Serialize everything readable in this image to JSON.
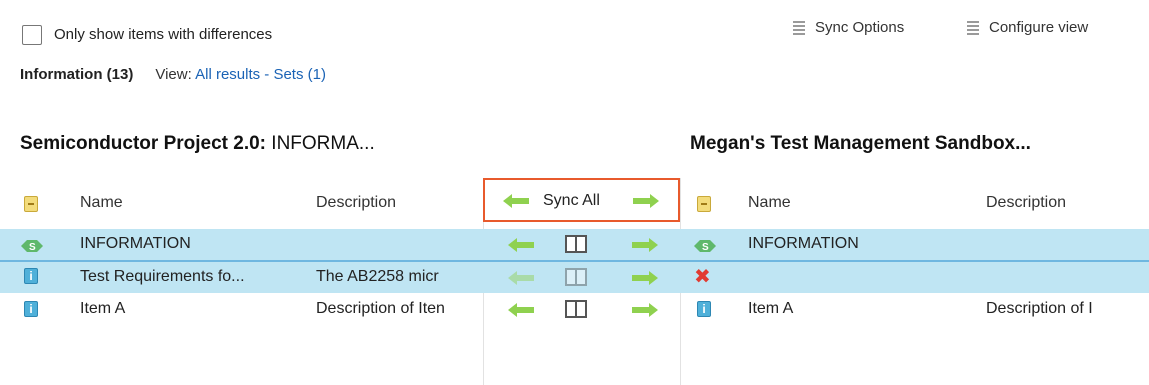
{
  "toolbar": {
    "filter_label": "Only show items with differences",
    "sync_options_label": "Sync Options",
    "configure_view_label": "Configure view"
  },
  "infobar": {
    "tab_label": "Information (13)",
    "view_prefix": "View:",
    "view_value": "All results - Sets (1)"
  },
  "left_panel": {
    "title_bold": "Semiconductor Project 2.0:",
    "title_rest": " INFORMA..."
  },
  "right_panel": {
    "title": "Megan's Test Management Sandbox..."
  },
  "columns": {
    "name": "Name",
    "description": "Description",
    "sync_all": "Sync All"
  },
  "rows": [
    {
      "left_icon": "set-icon",
      "left_name": "INFORMATION",
      "left_description": "",
      "right_icon": "set-icon",
      "right_name": "INFORMATION",
      "right_description": "",
      "selected": true
    },
    {
      "left_icon": "info-item-icon",
      "left_name": "Test Requirements fo...",
      "left_description": "The AB2258 micr",
      "right_icon": "missing-x-icon",
      "right_name": "",
      "right_description": "",
      "selected": true
    },
    {
      "left_icon": "info-item-icon",
      "left_name": "Item A",
      "left_description": "Description of Iten",
      "right_icon": "info-item-icon",
      "right_name": "Item A",
      "right_description": "Description of I",
      "selected": false
    }
  ],
  "colors": {
    "selected_row": "#bfe5f3",
    "highlight_border": "#e85a2c",
    "link": "#1b63b5",
    "sync_arrow": "#8fd14f"
  }
}
